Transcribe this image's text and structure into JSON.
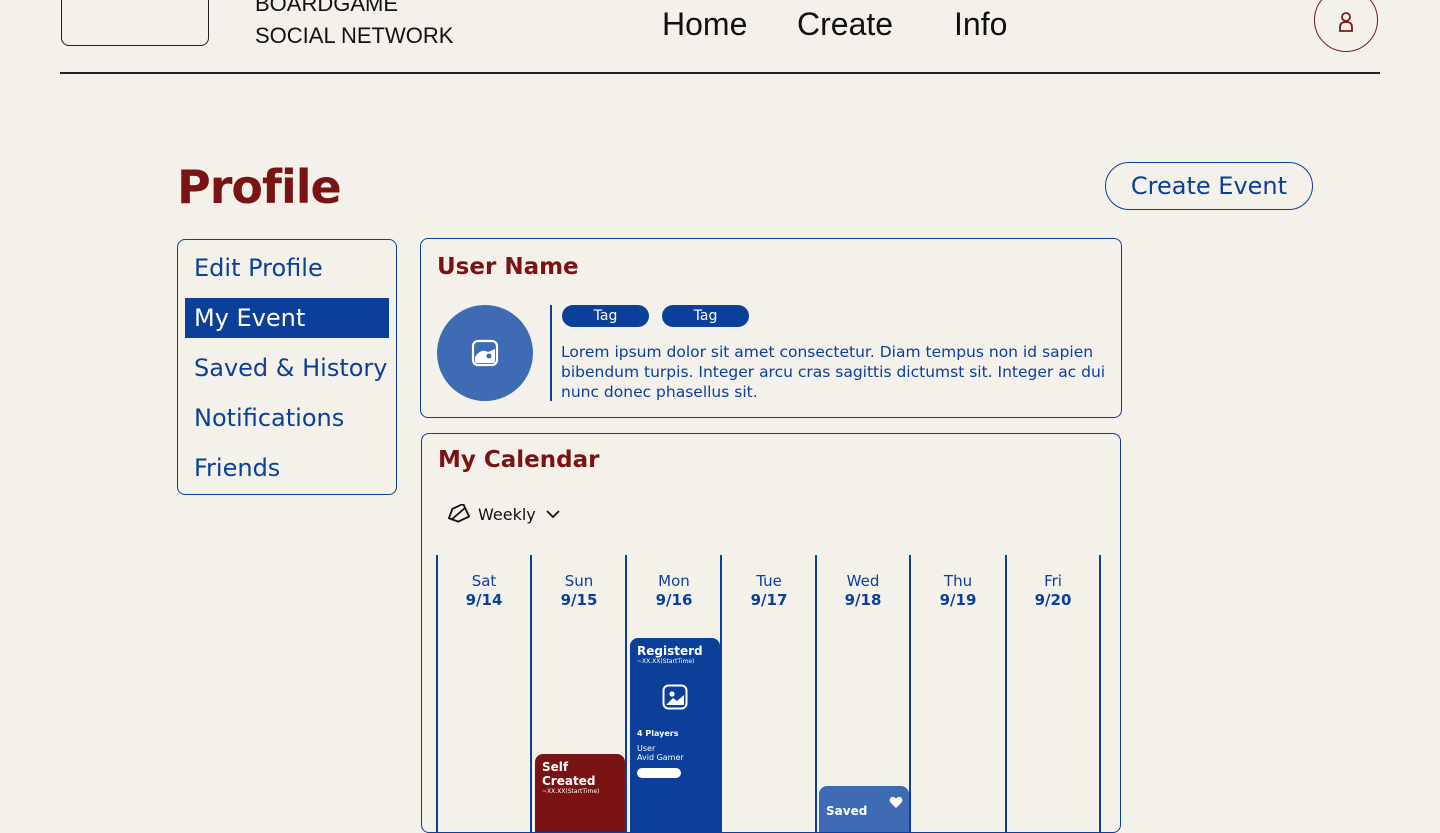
{
  "header": {
    "brand_line1": "BOARDGAME",
    "brand_line2": "SOCIAL NETWORK",
    "nav": [
      "Home",
      "Create",
      "Info"
    ]
  },
  "page": {
    "title": "Profile",
    "create_event_label": "Create Event"
  },
  "sidebar": {
    "items": [
      {
        "label": "Edit Profile",
        "active": false
      },
      {
        "label": "My Event",
        "active": true
      },
      {
        "label": "Saved & History",
        "active": false
      },
      {
        "label": "Notifications",
        "active": false
      },
      {
        "label": "Friends",
        "active": false
      }
    ]
  },
  "user": {
    "name": "User Name",
    "tags": [
      "Tag",
      "Tag"
    ],
    "bio": "Lorem ipsum dolor sit amet consectetur. Diam tempus non id sapien bibendum turpis. Integer arcu cras sagittis dictumst sit. Integer ac dui nunc donec phasellus sit."
  },
  "calendar": {
    "title": "My Calendar",
    "view": "Weekly",
    "days": [
      {
        "name": "Sat",
        "date": "9/14"
      },
      {
        "name": "Sun",
        "date": "9/15"
      },
      {
        "name": "Mon",
        "date": "9/16"
      },
      {
        "name": "Tue",
        "date": "9/17"
      },
      {
        "name": "Wed",
        "date": "9/18"
      },
      {
        "name": "Thu",
        "date": "9/19"
      },
      {
        "name": "Fri",
        "date": "9/20"
      }
    ],
    "events": {
      "registered": {
        "title": "Registerd",
        "time": "~XX.XX(StartTime)",
        "players": "4 Players",
        "host_label": "User",
        "host_desc": "Avid Gamer"
      },
      "self_created": {
        "title": "Self Created",
        "time": "~XX.XX(StartTime)"
      },
      "saved": {
        "title": "Saved"
      }
    }
  },
  "colors": {
    "background": "#f3f1ea",
    "primary_blue": "#0b3f9a",
    "accent_red": "#7a1414",
    "avatar_blue": "#3e6bb3"
  }
}
